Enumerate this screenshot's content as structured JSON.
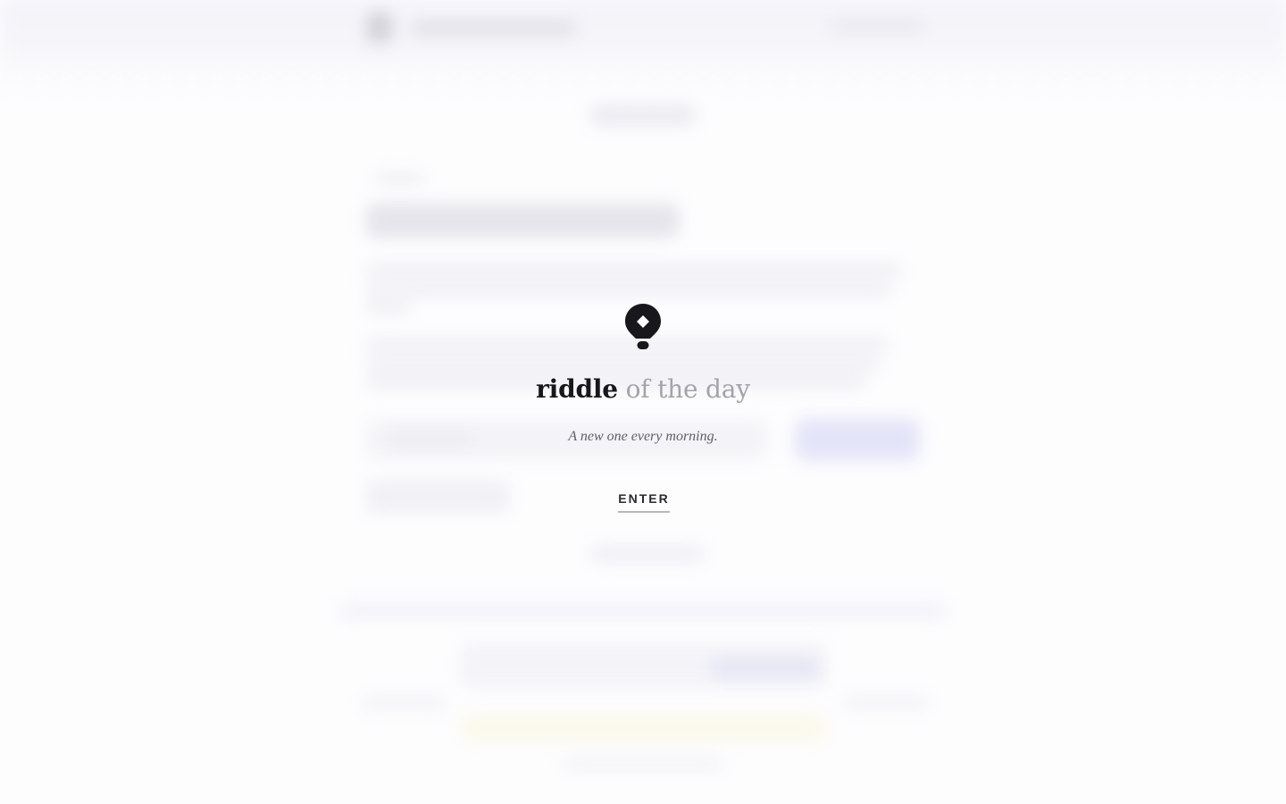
{
  "splash": {
    "logo_icon": "lightbulb-icon",
    "brand_strong": "riddle",
    "brand_light": "of the day",
    "tagline": "A new one every morning.",
    "enter_label": "ENTER"
  },
  "colors": {
    "ink": "#17171c",
    "muted": "#a3a3ab",
    "tagline": "#5e5e66",
    "background": "#fdfdfe"
  }
}
